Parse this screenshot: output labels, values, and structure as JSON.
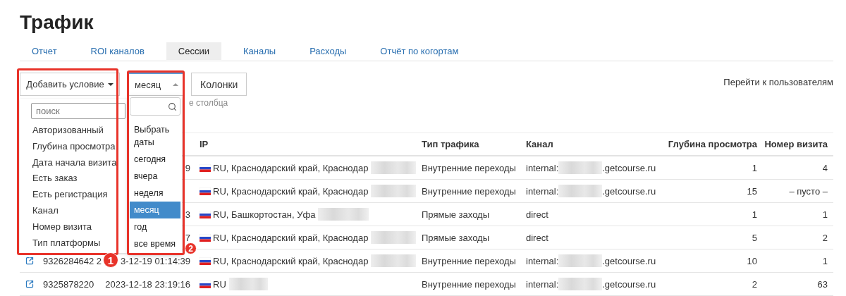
{
  "title": "Трафик",
  "tabs": [
    {
      "label": "Отчет",
      "selected": false
    },
    {
      "label": "ROI каналов",
      "selected": false
    },
    {
      "label": "Сессии",
      "selected": true
    },
    {
      "label": "Каналы",
      "selected": false
    },
    {
      "label": "Расходы",
      "selected": false
    },
    {
      "label": "Отчёт по когортам",
      "selected": false
    }
  ],
  "toolbar": {
    "add_condition": "Добавить условие",
    "period": "месяц",
    "columns_button": "Колонки",
    "users_link": "Перейти к пользователям",
    "hint": "е столбца"
  },
  "condition_menu": {
    "search_placeholder": "поиск",
    "items": [
      "Авторизованный",
      "Глубина просмотра",
      "Дата начала визита",
      "Есть заказ",
      "Есть регистрация",
      "Канал",
      "Номер визита",
      "Тип платформы"
    ]
  },
  "period_menu": {
    "options": [
      {
        "label": "Выбрать даты",
        "selected": false
      },
      {
        "label": "сегодня",
        "selected": false
      },
      {
        "label": "вчера",
        "selected": false
      },
      {
        "label": "неделя",
        "selected": false
      },
      {
        "label": "месяц",
        "selected": true
      },
      {
        "label": "год",
        "selected": false
      },
      {
        "label": "все время",
        "selected": false
      }
    ]
  },
  "annotations": [
    {
      "number": "1"
    },
    {
      "number": "2"
    }
  ],
  "table": {
    "columns": [
      "IP",
      "Тип трафика",
      "Канал",
      "Глубина просмотра",
      "Номер визита"
    ],
    "rows": [
      {
        "date": "9",
        "ip": {
          "text": "RU, Краснодарский край, Краснодар",
          "blurred": true
        },
        "traffic": "Внутренние переходы",
        "channel": {
          "parts": [
            "internal:",
            ".getcourse.ru"
          ],
          "blurred": true
        },
        "depth": "1",
        "visit": "4"
      },
      {
        "ip": {
          "text": "RU, Краснодарский край, Краснодар",
          "blurred": true
        },
        "traffic": "Внутренние переходы",
        "channel": {
          "parts": [
            "internal:",
            ".getcourse.ru"
          ],
          "blurred": true
        },
        "depth": "15",
        "visit": "– пусто –"
      },
      {
        "date": "3",
        "ip": {
          "text": "RU, Башкортостан, Уфа",
          "blurred": true
        },
        "traffic": "Прямые заходы",
        "channel": {
          "parts": [
            "direct"
          ],
          "blurred": false
        },
        "depth": "1",
        "visit": "1"
      },
      {
        "date": "7",
        "ip": {
          "text": "RU, Краснодарский край, Краснодар",
          "blurred": true
        },
        "traffic": "Прямые заходы",
        "channel": {
          "parts": [
            "direct"
          ],
          "blurred": false
        },
        "depth": "5",
        "visit": "2"
      },
      {
        "id": "9326284642",
        "date_lead": "2",
        "date": "3-12-19 01:14:39",
        "ip": {
          "text": "RU, Краснодарский край, Краснодар",
          "blurred": true
        },
        "traffic": "Внутренние переходы",
        "channel": {
          "parts": [
            "internal:",
            ".getcourse.ru"
          ],
          "blurred": true
        },
        "depth": "10",
        "visit": "1"
      },
      {
        "id": "9325878220",
        "date": "2023-12-18 23:19:16",
        "ip": {
          "text": "RU",
          "blurred": true
        },
        "traffic": "Внутренние переходы",
        "channel": {
          "parts": [
            "internal:",
            ".getcourse.ru"
          ],
          "blurred": true
        },
        "depth": "2",
        "visit": "63"
      }
    ]
  }
}
